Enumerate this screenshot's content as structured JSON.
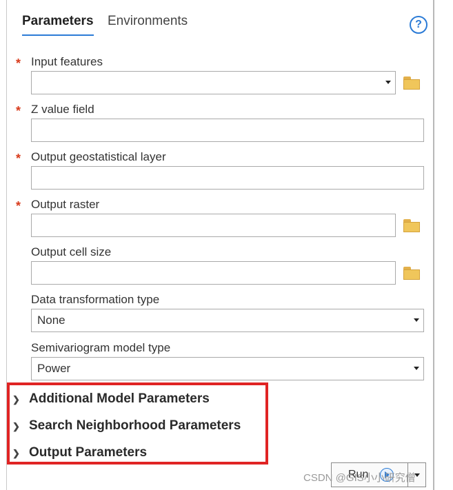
{
  "tabs": [
    {
      "label": "Parameters",
      "active": true
    },
    {
      "label": "Environments",
      "active": false
    }
  ],
  "help_icon": "help-circle-icon",
  "params": {
    "input_features": {
      "label": "Input features",
      "value": "",
      "required": true
    },
    "z_value_field": {
      "label": "Z value field",
      "value": "",
      "required": true
    },
    "output_geostat_layer": {
      "label": "Output geostatistical layer",
      "value": "",
      "required": true
    },
    "output_raster": {
      "label": "Output raster",
      "value": "",
      "required": true
    },
    "output_cell_size": {
      "label": "Output cell size",
      "value": "",
      "required": false
    },
    "data_transformation": {
      "label": "Data transformation type",
      "value": "None",
      "required": false
    },
    "semivariogram_model": {
      "label": "Semivariogram model type",
      "value": "Power",
      "required": false
    }
  },
  "required_mark": "*",
  "sections": [
    {
      "label": "Additional Model Parameters"
    },
    {
      "label": "Search Neighborhood Parameters"
    },
    {
      "label": "Output Parameters"
    }
  ],
  "run_label": "Run",
  "watermark": "CSDN @GIS小小研究僧",
  "colors": {
    "accent": "#2b7bd6",
    "required": "#d83b1c",
    "highlight_box": "#e02424"
  }
}
